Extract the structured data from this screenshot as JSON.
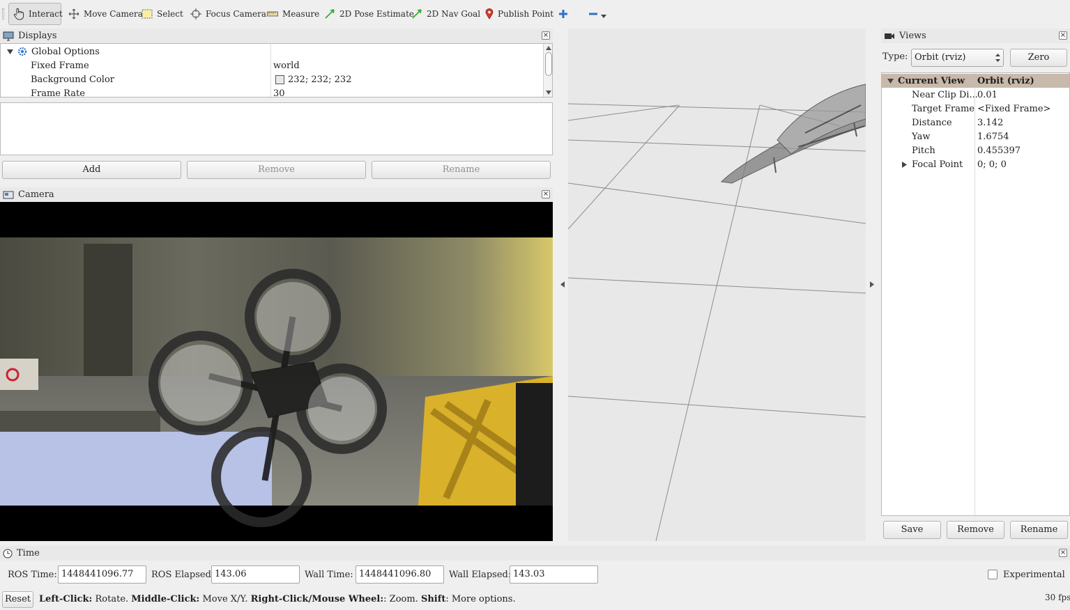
{
  "toolbar": {
    "interact": "Interact",
    "move_camera": "Move Camera",
    "select": "Select",
    "focus_camera": "Focus Camera",
    "measure": "Measure",
    "pose_estimate": "2D Pose Estimate",
    "nav_goal": "2D Nav Goal",
    "publish_point": "Publish Point"
  },
  "displays": {
    "title": "Displays",
    "global_options": "Global Options",
    "rows": [
      {
        "name": "Fixed Frame",
        "value": "world"
      },
      {
        "name": "Background Color",
        "value": "232; 232; 232"
      },
      {
        "name": "Frame Rate",
        "value": "30"
      }
    ],
    "add": "Add",
    "remove": "Remove",
    "rename": "Rename"
  },
  "camera": {
    "title": "Camera"
  },
  "views": {
    "title": "Views",
    "type_label": "Type:",
    "type_value": "Orbit (rviz)",
    "zero": "Zero",
    "current_view": "Current View",
    "current_view_value": "Orbit (rviz)",
    "rows": [
      {
        "name": "Near Clip Di...",
        "value": "0.01"
      },
      {
        "name": "Target Frame",
        "value": "<Fixed Frame>"
      },
      {
        "name": "Distance",
        "value": "3.142"
      },
      {
        "name": "Yaw",
        "value": "1.6754"
      },
      {
        "name": "Pitch",
        "value": "0.455397"
      },
      {
        "name": "Focal Point",
        "value": "0; 0; 0"
      }
    ],
    "save": "Save",
    "remove": "Remove",
    "rename": "Rename"
  },
  "time": {
    "title": "Time",
    "ros_time_label": "ROS Time:",
    "ros_time": "1448441096.77",
    "ros_elapsed_label": "ROS Elapsed:",
    "ros_elapsed": "143.06",
    "wall_time_label": "Wall Time:",
    "wall_time": "1448441096.80",
    "wall_elapsed_label": "Wall Elapsed:",
    "wall_elapsed": "143.03",
    "experimental": "Experimental"
  },
  "status": {
    "reset": "Reset",
    "left_click": "Left-Click:",
    "left_click_action": "Rotate.",
    "middle_click": "Middle-Click:",
    "middle_click_action": "Move X/Y.",
    "right_click": "Right-Click/Mouse Wheel:",
    "right_click_action": ": Zoom.",
    "shift": "Shift",
    "shift_action": ": More options.",
    "fps": "30 fps"
  },
  "colors": {
    "window_bg": "#efefef",
    "viewport_bg": "#e8e8e8",
    "selection": "#c7b9ab",
    "camera_letterbox": "#000000"
  }
}
